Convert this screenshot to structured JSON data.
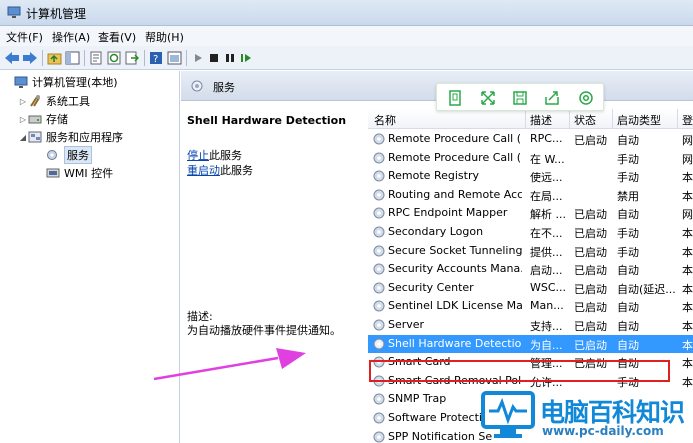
{
  "window": {
    "title": "计算机管理"
  },
  "menu": [
    "文件(F)",
    "操作(A)",
    "查看(V)",
    "帮助(H)"
  ],
  "tree": {
    "root": "计算机管理(本地)",
    "items": [
      {
        "label": "系统工具",
        "icon": "tools-icon"
      },
      {
        "label": "存储",
        "icon": "storage-icon"
      },
      {
        "label": "服务和应用程序",
        "icon": "services-apps-icon"
      },
      {
        "label": "服务",
        "icon": "services-gear-icon"
      },
      {
        "label": "WMI 控件",
        "icon": "wmi-icon"
      }
    ]
  },
  "header": {
    "title": "服务"
  },
  "description_pane": {
    "service_title": "Shell Hardware Detection",
    "stop_link": "停止",
    "stop_suffix": "此服务",
    "restart_link": "重启动",
    "restart_suffix": "此服务",
    "desc_label": "描述:",
    "desc_text": "为自动播放硬件事件提供通知。"
  },
  "list": {
    "columns": [
      "名称",
      "描述",
      "状态",
      "启动类型",
      "登"
    ],
    "rows": [
      {
        "name": "Remote Procedure Call (...",
        "desc": "RPC...",
        "status": "已启动",
        "startup": "自动",
        "logon": "网"
      },
      {
        "name": "Remote Procedure Call (...",
        "desc": "在 W...",
        "status": "",
        "startup": "手动",
        "logon": "网"
      },
      {
        "name": "Remote Registry",
        "desc": "使远...",
        "status": "",
        "startup": "手动",
        "logon": "本"
      },
      {
        "name": "Routing and Remote Acc...",
        "desc": "在局...",
        "status": "",
        "startup": "禁用",
        "logon": "本"
      },
      {
        "name": "RPC Endpoint Mapper",
        "desc": "解析 ...",
        "status": "已启动",
        "startup": "自动",
        "logon": "网"
      },
      {
        "name": "Secondary Logon",
        "desc": "在不...",
        "status": "已启动",
        "startup": "手动",
        "logon": "本"
      },
      {
        "name": "Secure Socket Tunneling...",
        "desc": "提供...",
        "status": "已启动",
        "startup": "手动",
        "logon": "本"
      },
      {
        "name": "Security Accounts Mana...",
        "desc": "启动...",
        "status": "已启动",
        "startup": "自动",
        "logon": "本"
      },
      {
        "name": "Security Center",
        "desc": "WSC...",
        "status": "已启动",
        "startup": "自动(延迟...",
        "logon": "本"
      },
      {
        "name": "Sentinel LDK License Ma...",
        "desc": "Man...",
        "status": "已启动",
        "startup": "自动",
        "logon": "本"
      },
      {
        "name": "Server",
        "desc": "支持...",
        "status": "已启动",
        "startup": "自动",
        "logon": "本"
      },
      {
        "name": "Shell Hardware Detection",
        "desc": "为自...",
        "status": "已启动",
        "startup": "自动",
        "logon": "本",
        "selected": true
      },
      {
        "name": "Smart Card",
        "desc": "管理...",
        "status": "已启动",
        "startup": "自动",
        "logon": "本"
      },
      {
        "name": "Smart Card Removal Pol...",
        "desc": "允许...",
        "status": "",
        "startup": "手动",
        "logon": "本"
      },
      {
        "name": "SNMP Trap",
        "desc": "",
        "status": "",
        "startup": "",
        "logon": ""
      },
      {
        "name": "Software Protectio",
        "desc": "",
        "status": "",
        "startup": "",
        "logon": ""
      },
      {
        "name": "SPP Notification Se",
        "desc": "",
        "status": "",
        "startup": "",
        "logon": ""
      }
    ]
  },
  "floating_toolbar": [
    "page-icon",
    "expand-icon",
    "save-icon",
    "share-icon",
    "settings-icon"
  ],
  "colors": {
    "selection": "#3399ff",
    "highlight_box": "#e02020",
    "arrow": "#e040e0",
    "logo_blue": "#1188d8"
  },
  "watermark": {
    "main": "电脑百科知识",
    "url": "www.pc-daily.com"
  }
}
